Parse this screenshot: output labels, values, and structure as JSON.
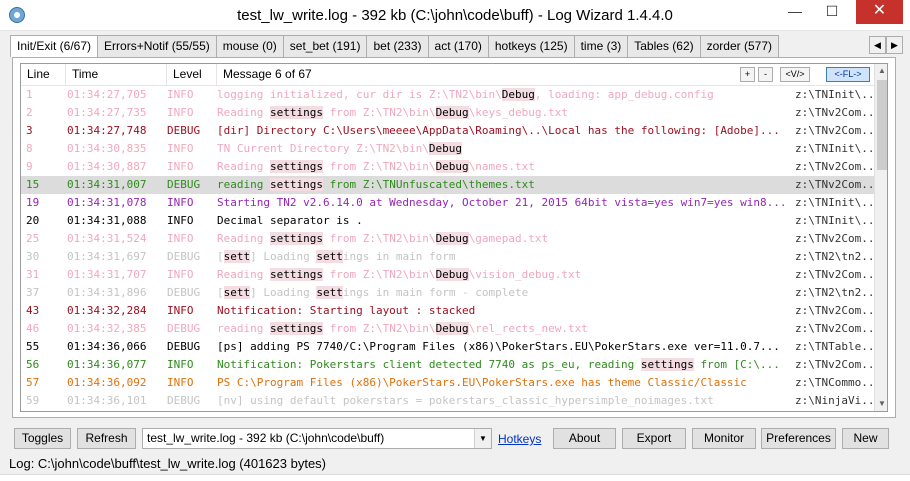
{
  "window": {
    "title": "test_lw_write.log - 392 kb (C:\\john\\code\\buff) - Log Wizard 1.4.4.0",
    "minimize": "—",
    "maximize": "☐",
    "close": "✕"
  },
  "tabs": [
    {
      "label": "Init/Exit (6/67)",
      "active": true
    },
    {
      "label": "Errors+Notif (55/55)"
    },
    {
      "label": "mouse (0)"
    },
    {
      "label": "set_bet (191)"
    },
    {
      "label": "bet (233)"
    },
    {
      "label": "act (170)"
    },
    {
      "label": "hotkeys (125)"
    },
    {
      "label": "time (3)"
    },
    {
      "label": "Tables (62)"
    },
    {
      "label": "zorder (577)"
    }
  ],
  "tab_scroll": {
    "left": "◀",
    "right": "▶"
  },
  "log_header": {
    "line": "Line",
    "time": "Time",
    "level": "Level",
    "message": "Message 6 of 67",
    "btn_plus": "+",
    "btn_minus": "-",
    "btn_view": "<V/>",
    "btn_fl": "<-FL->"
  },
  "colors": {
    "faded": "#f0a8bc",
    "faded_gray": "#c4c4c4",
    "dark_red": "#9b0d1e",
    "black": "#000000",
    "green": "#2f8a1e",
    "purple": "#9525b5",
    "orange": "#e0700a",
    "source": "#333333"
  },
  "rows": [
    {
      "line": "1",
      "time": "01:34:27,705",
      "level": "INFO",
      "color": "faded",
      "msg": [
        {
          "t": "logging initialized, cur dir is Z:\\TN2\\bin\\"
        },
        {
          "t": "Debug",
          "h": true
        },
        {
          "t": ", loading: app_debug.config"
        }
      ],
      "src": "z:\\TNInit\\..."
    },
    {
      "line": "2",
      "time": "01:34:27,735",
      "level": "INFO",
      "color": "faded",
      "msg": [
        {
          "t": "Reading "
        },
        {
          "t": "settings",
          "h": true
        },
        {
          "t": " from Z:\\TN2\\bin\\"
        },
        {
          "t": "Debug",
          "h": true
        },
        {
          "t": "\\keys_debug.txt"
        }
      ],
      "src": "z:\\TNv2Com..."
    },
    {
      "line": "3",
      "time": "01:34:27,748",
      "level": "DEBUG",
      "color": "dark_red",
      "msg": [
        {
          "t": "[dir] Directory C:\\Users\\meeee\\AppData\\Roaming\\..\\Local has the following: [Adobe]..."
        }
      ],
      "src": "z:\\TNv2Com..."
    },
    {
      "line": "8",
      "time": "01:34:30,835",
      "level": "INFO",
      "color": "faded",
      "msg": [
        {
          "t": "TN Current Directory Z:\\TN2\\bin\\"
        },
        {
          "t": "Debug",
          "h": true
        }
      ],
      "src": "z:\\TNInit\\..."
    },
    {
      "line": "9",
      "time": "01:34:30,887",
      "level": "INFO",
      "color": "faded",
      "msg": [
        {
          "t": "Reading "
        },
        {
          "t": "settings",
          "h": true
        },
        {
          "t": " from Z:\\TN2\\bin\\"
        },
        {
          "t": "Debug",
          "h": true
        },
        {
          "t": "\\names.txt"
        }
      ],
      "src": "z:\\TNv2Com..."
    },
    {
      "line": "15",
      "time": "01:34:31,007",
      "level": "DEBUG",
      "color": "green",
      "selected": true,
      "msg": [
        {
          "t": "reading "
        },
        {
          "t": "settings",
          "h": true
        },
        {
          "t": " from Z:\\TNUnfuscated\\themes.txt"
        }
      ],
      "src": "z:\\TNv2Com..."
    },
    {
      "line": "19",
      "time": "01:34:31,078",
      "level": "INFO",
      "color": "purple",
      "msg": [
        {
          "t": "Starting TN2 v2.6.14.0 at Wednesday, October 21, 2015 64bit vista=yes win7=yes win8..."
        }
      ],
      "src": "z:\\TNInit\\..."
    },
    {
      "line": "20",
      "time": "01:34:31,088",
      "level": "INFO",
      "color": "black",
      "msg": [
        {
          "t": "Decimal separator is ."
        }
      ],
      "src": "z:\\TNInit\\..."
    },
    {
      "line": "25",
      "time": "01:34:31,524",
      "level": "INFO",
      "color": "faded",
      "msg": [
        {
          "t": "Reading "
        },
        {
          "t": "settings",
          "h": true
        },
        {
          "t": " from Z:\\TN2\\bin\\"
        },
        {
          "t": "Debug",
          "h": true
        },
        {
          "t": "\\gamepad.txt"
        }
      ],
      "src": "z:\\TNv2Com..."
    },
    {
      "line": "30",
      "time": "01:34:31,697",
      "level": "DEBUG",
      "color": "faded_gray",
      "msg": [
        {
          "t": "["
        },
        {
          "t": "sett",
          "h": true
        },
        {
          "t": "] Loading "
        },
        {
          "t": "sett",
          "h": true
        },
        {
          "t": "ings in main form"
        }
      ],
      "src": "z:\\TN2\\tn2..."
    },
    {
      "line": "31",
      "time": "01:34:31,707",
      "level": "INFO",
      "color": "faded",
      "msg": [
        {
          "t": "Reading "
        },
        {
          "t": "settings",
          "h": true
        },
        {
          "t": " from Z:\\TN2\\bin\\"
        },
        {
          "t": "Debug",
          "h": true
        },
        {
          "t": "\\vision_debug.txt"
        }
      ],
      "src": "z:\\TNv2Com..."
    },
    {
      "line": "37",
      "time": "01:34:31,896",
      "level": "DEBUG",
      "color": "faded_gray",
      "msg": [
        {
          "t": "["
        },
        {
          "t": "sett",
          "h": true
        },
        {
          "t": "] Loading "
        },
        {
          "t": "sett",
          "h": true
        },
        {
          "t": "ings in main form - complete"
        }
      ],
      "src": "z:\\TN2\\tn2..."
    },
    {
      "line": "43",
      "time": "01:34:32,284",
      "level": "INFO",
      "color": "dark_red",
      "msg": [
        {
          "t": "Notification: Starting layout : stacked"
        }
      ],
      "src": "z:\\TNv2Com..."
    },
    {
      "line": "46",
      "time": "01:34:32,385",
      "level": "DEBUG",
      "color": "faded",
      "msg": [
        {
          "t": "reading "
        },
        {
          "t": "settings",
          "h": true
        },
        {
          "t": " from Z:\\TN2\\bin\\"
        },
        {
          "t": "Debug",
          "h": true
        },
        {
          "t": "\\rel_rects_new.txt"
        }
      ],
      "src": "z:\\TNv2Com..."
    },
    {
      "line": "55",
      "time": "01:34:36,066",
      "level": "DEBUG",
      "color": "black",
      "msg": [
        {
          "t": "[ps] adding PS 7740/C:\\Program Files (x86)\\PokerStars.EU\\PokerStars.exe ver=11.0.7..."
        }
      ],
      "src": "z:\\TNTable..."
    },
    {
      "line": "56",
      "time": "01:34:36,077",
      "level": "INFO",
      "color": "green",
      "msg": [
        {
          "t": "Notification: Pokerstars client detected 7740 as ps_eu, reading "
        },
        {
          "t": "settings",
          "h": true
        },
        {
          "t": " from [C:\\..."
        }
      ],
      "src": "z:\\TNv2Com..."
    },
    {
      "line": "57",
      "time": "01:34:36,092",
      "level": "INFO",
      "color": "orange",
      "msg": [
        {
          "t": "PS C:\\Program Files (x86)\\PokerStars.EU\\PokerStars.exe has theme Classic/Classic"
        }
      ],
      "src": "z:\\TNCommo..."
    },
    {
      "line": "59",
      "time": "01:34:36,101",
      "level": "DEBUG",
      "color": "faded_gray",
      "msg": [
        {
          "t": "[nv] using default pokerstars = pokerstars_classic_hypersimple_noimages.txt"
        }
      ],
      "src": "z:\\NinjaVi..."
    }
  ],
  "scroll": {
    "up": "▲",
    "down": "▼"
  },
  "toolbar": {
    "toggles": "Toggles",
    "refresh": "Refresh",
    "file_combo": "test_lw_write.log - 392 kb (C:\\john\\code\\buff)",
    "combo_arrow": "▼",
    "hotkeys_link": "Hotkeys",
    "about": "About",
    "export": "Export",
    "monitor": "Monitor",
    "preferences": "Preferences",
    "new": "New"
  },
  "status": {
    "text": "Log: C:\\john\\code\\buff\\test_lw_write.log (401623 bytes)"
  }
}
